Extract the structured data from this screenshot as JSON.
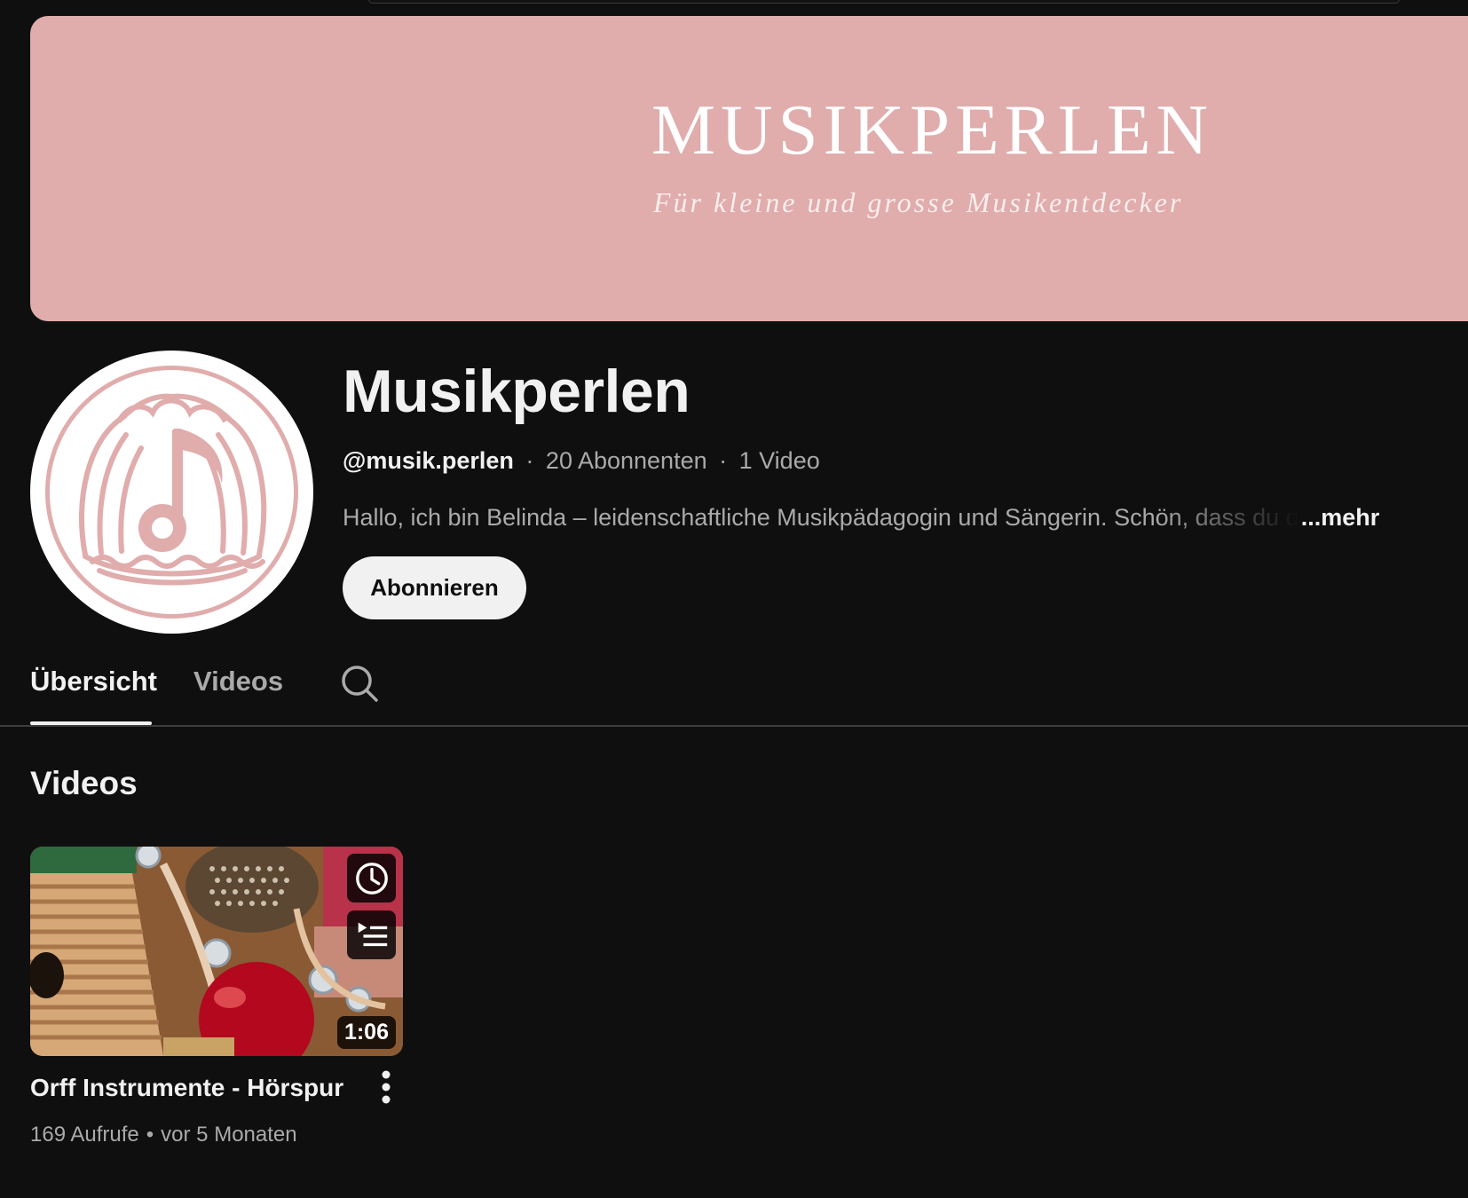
{
  "banner": {
    "title": "MUSIKPERLEN",
    "subtitle": "Für kleine und grosse Musikentdecker",
    "background_color": "#e0acac"
  },
  "channel": {
    "name": "Musikperlen",
    "handle": "@musik.perlen",
    "subscribers": "20 Abonnenten",
    "video_count": "1 Video",
    "separator": "·",
    "description": "Hallo, ich bin Belinda – leidenschaftliche Musikpädagogin und Sängerin. Schön, dass du d",
    "more_label": "...mehr",
    "avatar_icon": "pearl-shell-music-note-logo"
  },
  "subscribe_button": {
    "label": "Abonnieren"
  },
  "tabs": [
    {
      "label": "Übersicht",
      "active": true
    },
    {
      "label": "Videos",
      "active": false
    }
  ],
  "search_icon": "search-icon",
  "section": {
    "heading": "Videos"
  },
  "videos": [
    {
      "title": "Orff Instrumente - Hörspur",
      "duration": "1:06",
      "views": "169 Aufrufe",
      "age": "vor 5 Monaten",
      "separator": "•",
      "overlay_icons": [
        "watch-later-icon",
        "add-to-queue-icon"
      ]
    }
  ],
  "colors": {
    "background": "#0f0f0f",
    "text_primary": "#f1f1f1",
    "text_secondary": "#aaaaaa",
    "logo_pink": "#e0acac"
  }
}
